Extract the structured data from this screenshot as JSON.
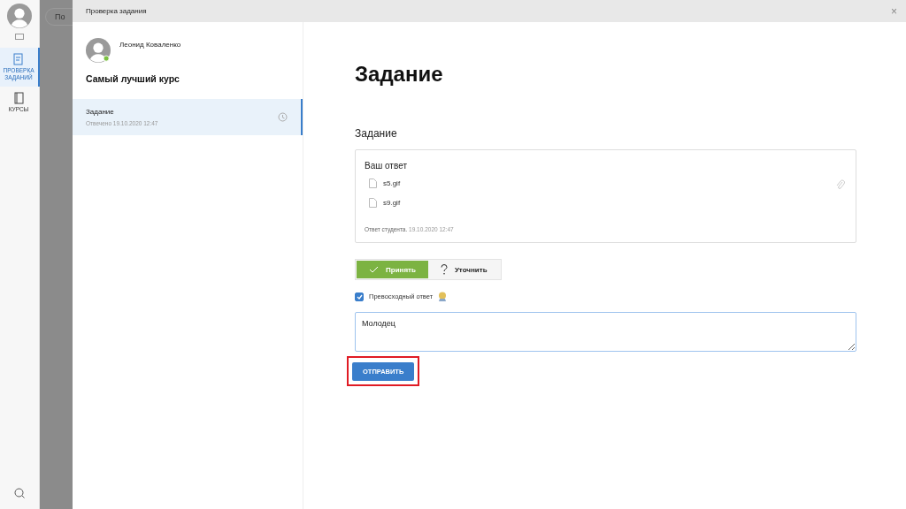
{
  "sidebar": {
    "items": [
      {
        "label": "ПРОВЕРКА ЗАДАНИЙ",
        "kind": "review",
        "selected": true
      },
      {
        "label": "КУРСЫ",
        "kind": "courses",
        "selected": false
      }
    ]
  },
  "background": {
    "search_placeholder": "По"
  },
  "modal": {
    "title": "Проверка задания",
    "close": "×",
    "student": {
      "name": "Леонид Коваленко",
      "online": true
    },
    "course": "Самый лучший курс",
    "tasks": [
      {
        "title": "Задание",
        "meta": "Отвечено 19.10.2020 12:47",
        "selected": true
      }
    ],
    "heading": "Задание",
    "subheading": "Задание",
    "answer": {
      "title": "Ваш ответ",
      "files": [
        "s5.gif",
        "s9.gif"
      ],
      "footer_label": "Ответ студента.",
      "footer_date": "19.10.2020 12:47"
    },
    "decisions": [
      {
        "label": "Принять",
        "kind": "accept",
        "selected": true
      },
      {
        "label": "Уточнить",
        "kind": "clarify",
        "selected": false
      }
    ],
    "excellent": {
      "label": "Превосходный ответ",
      "checked": true
    },
    "comment": "Молодец",
    "submit": {
      "label": "ОТПРАВИТЬ",
      "highlighted": true
    }
  }
}
